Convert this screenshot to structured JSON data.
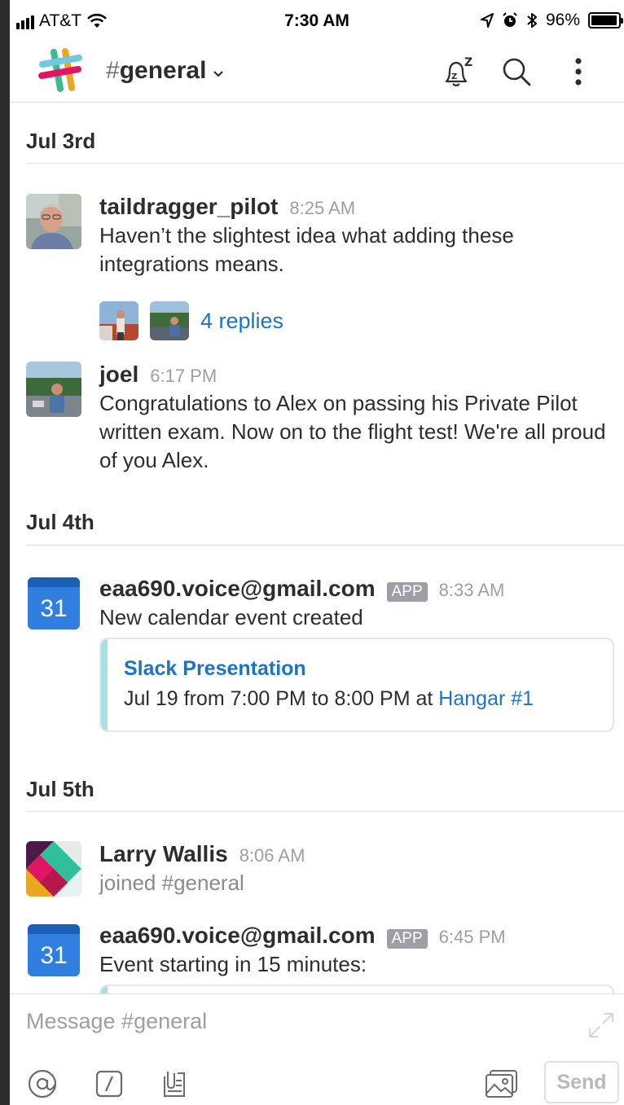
{
  "status": {
    "carrier": "AT&T",
    "time": "7:30 AM",
    "battery": "96%",
    "battery_level": 0.96
  },
  "header": {
    "channel_hash": "#",
    "channel_name": "general",
    "icons": [
      "slack-logo",
      "snooze-bell-icon",
      "search-icon",
      "more-vertical-icon"
    ]
  },
  "messages": {
    "dates": [
      "Jul 3rd",
      "Jul 4th",
      "Jul 5th"
    ],
    "m1": {
      "author": "taildragger_pilot",
      "time": "8:25 AM",
      "text": "Haven’t the slightest idea what adding these integrations means.",
      "replies": "4 replies"
    },
    "m2": {
      "author": "joel",
      "time": "6:17 PM",
      "text": "Congratulations to Alex on passing his Private Pilot written exam. Now on to the flight test! We're all proud of you Alex."
    },
    "m3": {
      "author": "eaa690.voice@gmail.com",
      "badge": "APP",
      "time": "8:33 AM",
      "text": "New calendar event created",
      "calendar_day": "31",
      "attachment": {
        "title": "Slack Presentation",
        "detail": "Jul 19 from 7:00 PM to 8:00 PM at ",
        "location": "Hangar #1"
      }
    },
    "m4": {
      "author": "Larry Wallis",
      "time": "8:06 AM",
      "text": "joined #general"
    },
    "m5": {
      "author": "eaa690.voice@gmail.com",
      "badge": "APP",
      "time": "6:45 PM",
      "text": "Event starting in 15 minutes:",
      "calendar_day": "31"
    }
  },
  "composer": {
    "placeholder": "Message #general",
    "send_label": "Send"
  },
  "colors": {
    "link": "#1d74c0",
    "attachment_bar": "#a6e0e3",
    "calendar_blue": "#2f7ee0"
  }
}
